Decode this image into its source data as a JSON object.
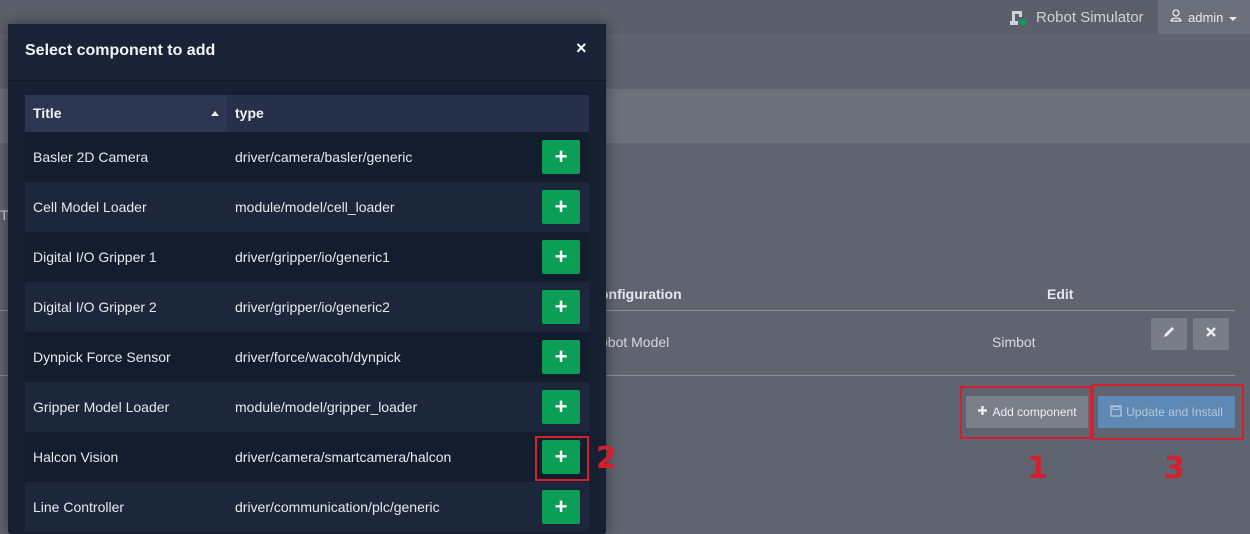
{
  "topbar": {
    "app_title": "Robot Simulator",
    "app_icon": "robot-arm-icon",
    "user_label": "admin",
    "user_icon": "user-icon"
  },
  "page": {
    "partial_text": "T",
    "table": {
      "col_configuration": "onfiguration",
      "col_edit": "Edit",
      "row": {
        "configuration": "obot Model",
        "value": "Simbot"
      }
    },
    "buttons": {
      "add_component": "Add component",
      "update_install": "Update and Install"
    }
  },
  "modal": {
    "title": "Select component to add",
    "close": "×",
    "columns": {
      "title": "Title",
      "type": "type"
    },
    "rows": [
      {
        "title": "Basler 2D Camera",
        "type": "driver/camera/basler/generic"
      },
      {
        "title": "Cell Model Loader",
        "type": "module/model/cell_loader"
      },
      {
        "title": "Digital I/O Gripper 1",
        "type": "driver/gripper/io/generic1"
      },
      {
        "title": "Digital I/O Gripper 2",
        "type": "driver/gripper/io/generic2"
      },
      {
        "title": "Dynpick Force Sensor",
        "type": "driver/force/wacoh/dynpick"
      },
      {
        "title": "Gripper Model Loader",
        "type": "module/model/gripper_loader"
      },
      {
        "title": "Halcon Vision",
        "type": "driver/camera/smartcamera/halcon"
      },
      {
        "title": "Line Controller",
        "type": "driver/communication/plc/generic"
      }
    ],
    "add_glyph": "+"
  },
  "annotations": {
    "one": "1",
    "two": "2",
    "three": "3"
  },
  "colors": {
    "add_green": "#0c9e57",
    "annotation_red": "#d2202e",
    "update_blue": "#5e89b4"
  }
}
